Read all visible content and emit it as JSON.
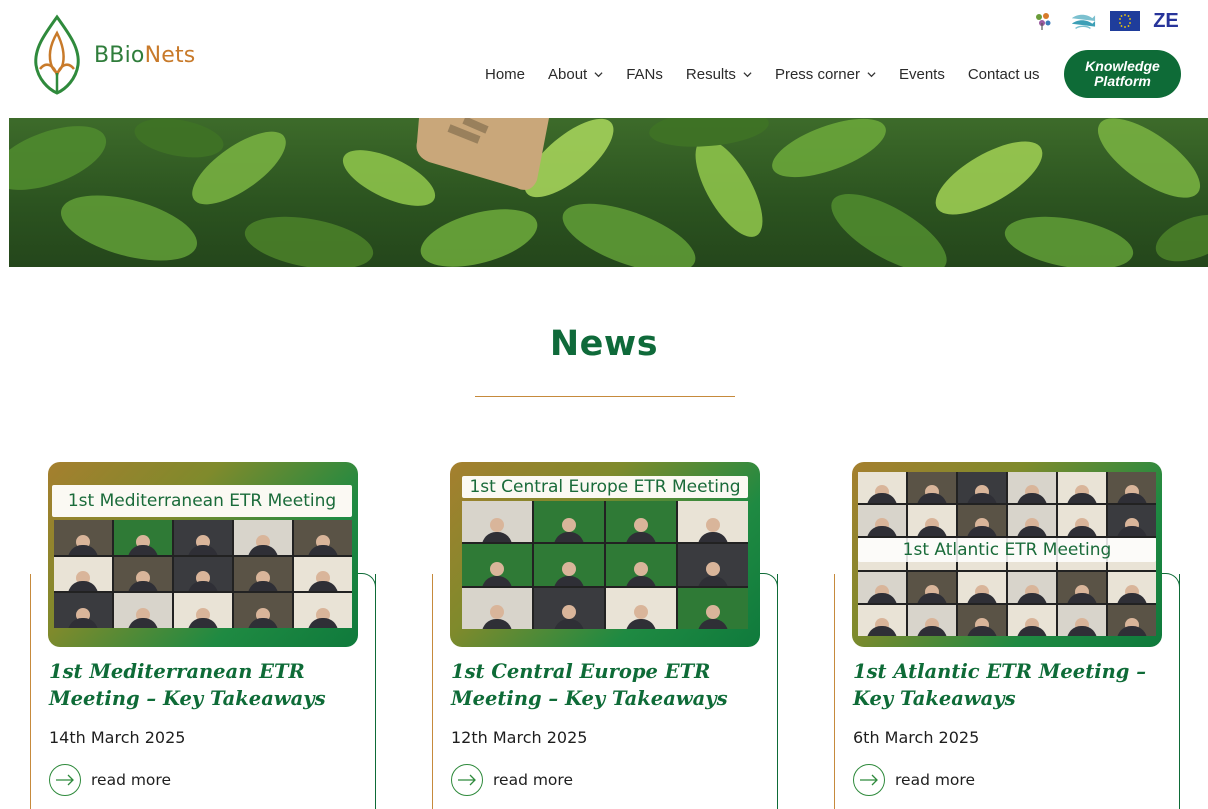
{
  "brand": {
    "name_part1": "BBio",
    "name_part2": "Nets"
  },
  "partners": [
    {
      "icon": "flower-logo-icon"
    },
    {
      "icon": "fish-logo-icon"
    },
    {
      "icon": "eu-flag-icon"
    },
    {
      "icon": "ze-logo-icon",
      "text": "ZE"
    }
  ],
  "nav": {
    "items": [
      {
        "label": "Home",
        "dropdown": false
      },
      {
        "label": "About",
        "dropdown": true
      },
      {
        "label": "FANs",
        "dropdown": false
      },
      {
        "label": "Results",
        "dropdown": true
      },
      {
        "label": "Press corner",
        "dropdown": true
      },
      {
        "label": "Events",
        "dropdown": false
      },
      {
        "label": "Contact us",
        "dropdown": false
      }
    ],
    "cta_label": "Knowledge Platform"
  },
  "news": {
    "heading": "News",
    "read_more_label": "read more",
    "cards": [
      {
        "thumb_banner": "1st Mediterranean ETR Meeting",
        "title": "1st Mediterranean ETR Meeting – Key Takeaways",
        "date": "14th March 2025"
      },
      {
        "thumb_banner": "1st Central Europe ETR Meeting",
        "title": "1st Central Europe ETR Meeting – Key Takeaways",
        "date": "12th March 2025"
      },
      {
        "thumb_banner": "1st Atlantic ETR Meeting",
        "title": "1st Atlantic ETR Meeting – Key Takeaways",
        "date": "6th March 2025"
      }
    ]
  },
  "colors": {
    "brand_green": "#0e6b37",
    "accent_gold": "#c68a3c"
  }
}
